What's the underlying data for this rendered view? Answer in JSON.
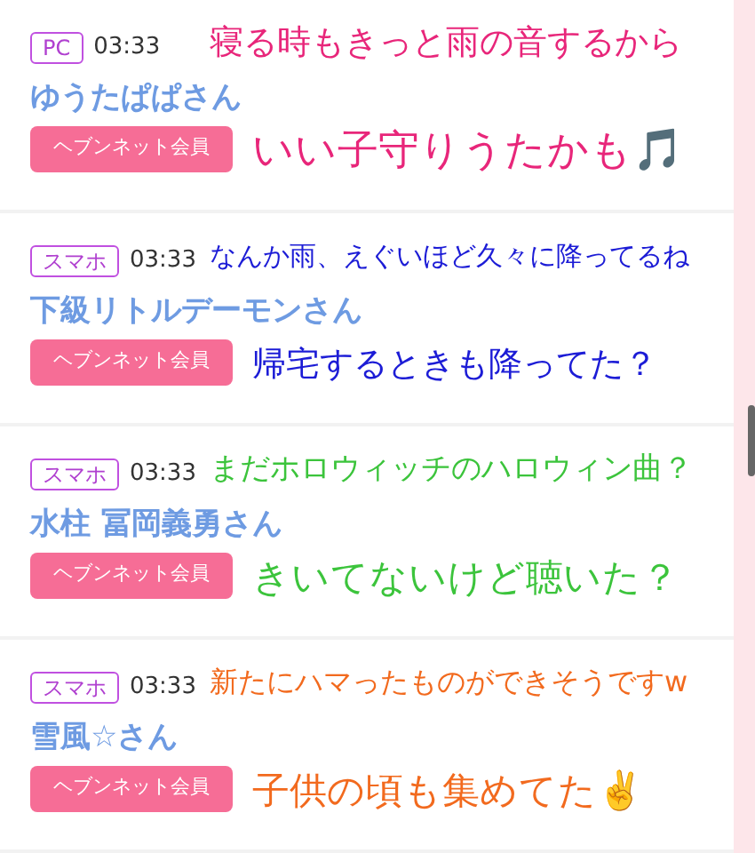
{
  "posts": [
    {
      "tag": "PC",
      "time": "03:33",
      "name": "ゆうたぱぱさん",
      "badge": "ヘブンネット会員",
      "overlay": {
        "color": "#e8267a",
        "lines": [
          "寝る時もきっと雨の音するから",
          "いい子守りうたかも🎵"
        ]
      }
    },
    {
      "tag": "スマホ",
      "time": "03:33",
      "name": "下級リトルデーモンさん",
      "badge": "ヘブンネット会員",
      "overlay": {
        "color": "#1c1cd6",
        "lines": [
          "なんか雨、えぐいほど久々に降ってるね",
          "帰宅するときも降ってた？"
        ]
      }
    },
    {
      "tag": "スマホ",
      "time": "03:33",
      "name": "水柱 冨岡義勇さん",
      "badge": "ヘブンネット会員",
      "overlay": {
        "color": "#3cc43c",
        "lines": [
          "まだホロウィッチのハロウィン曲？",
          "きいてないけど聴いた？"
        ]
      }
    },
    {
      "tag": "スマホ",
      "time": "03:33",
      "name": "雪風☆さん",
      "badge": "ヘブンネット会員",
      "overlay": {
        "color": "#f26a1e",
        "lines": [
          "新たにハマったものができそうですw",
          "子供の頃も集めてた✌️"
        ]
      }
    }
  ]
}
